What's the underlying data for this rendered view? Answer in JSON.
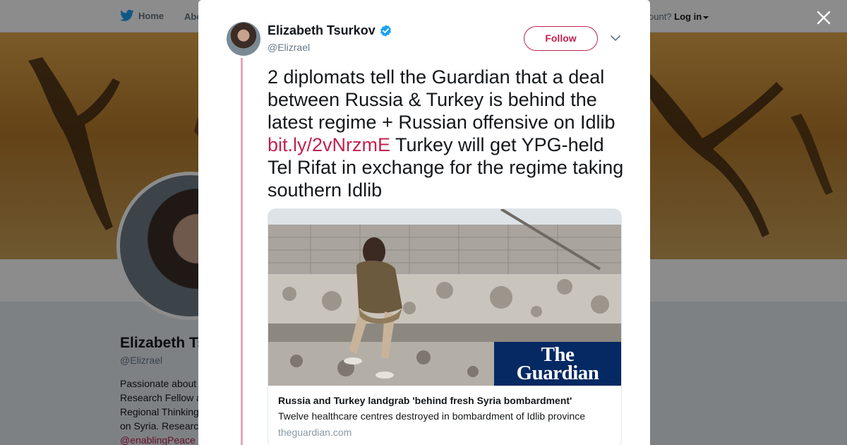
{
  "topnav": {
    "home_label": "Home",
    "about_label": "Abo",
    "account_prompt": "ccount?",
    "login_label": "Log in",
    "twitter_icon": "twitter-bird-icon",
    "brand_color": "#1da1f2"
  },
  "profile": {
    "name": "Elizabeth Ts",
    "handle": "@Elizrael",
    "bio_lines": [
      "Passionate about",
      "Research Fellow a",
      "Regional Thinking",
      "on Syria. Researc"
    ],
    "bio_mention": "@enablingPeace",
    "bio_tail": " ."
  },
  "modal": {
    "close_icon": "close-icon",
    "author": {
      "name": "Elizabeth Tsurkov",
      "handle": "@Elizrael",
      "verified_icon": "verified-badge-icon",
      "verified_color": "#1da1f2"
    },
    "follow_label": "Follow",
    "more_icon": "chevron-down-icon",
    "accent_color": "#c1234f",
    "tweet": {
      "text_before_link": "2 diplomats tell the Guardian that a deal between Russia & Turkey is behind the latest regime + Russian offensive on Idlib ",
      "link": "bit.ly/2vNrzmE",
      "text_after_link": " Turkey will get YPG-held Tel Rifat in exchange for the regime taking southern Idlib"
    },
    "card": {
      "logo_line1": "The",
      "logo_line2": "Guardian",
      "title": "Russia and Turkey landgrab 'behind fresh Syria bombardment'",
      "description": "Twelve healthcare centres destroyed in bombardment of Idlib province",
      "domain": "theguardian.com"
    }
  }
}
